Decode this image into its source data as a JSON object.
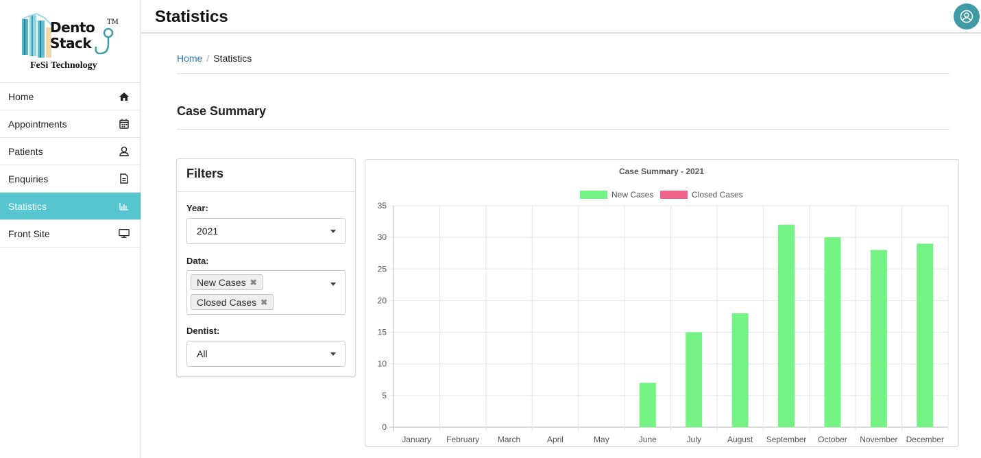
{
  "sidebar": {
    "logo": {
      "line1": "Dento",
      "line2": "Stack",
      "tm": "TM",
      "sub": "FeSi Technology"
    },
    "items": [
      {
        "label": "Home",
        "icon": "home-icon"
      },
      {
        "label": "Appointments",
        "icon": "calendar-icon"
      },
      {
        "label": "Patients",
        "icon": "user-icon"
      },
      {
        "label": "Enquiries",
        "icon": "document-icon"
      },
      {
        "label": "Statistics",
        "icon": "bar-chart-icon",
        "active": true
      },
      {
        "label": "Front Site",
        "icon": "monitor-icon"
      }
    ]
  },
  "header": {
    "title": "Statistics",
    "avatar_icon": "user-circle-icon"
  },
  "breadcrumb": {
    "home": "Home",
    "separator": "/",
    "current": "Statistics"
  },
  "section": {
    "title": "Case Summary"
  },
  "filters": {
    "title": "Filters",
    "year": {
      "label": "Year:",
      "value": "2021"
    },
    "data": {
      "label": "Data:",
      "tags": [
        "New Cases",
        "Closed Cases"
      ],
      "remove_glyph": "✖"
    },
    "dentist": {
      "label": "Dentist:",
      "value": "All"
    }
  },
  "colors": {
    "accent": "#56c5d0",
    "avatar": "#3e9aa3",
    "new_cases": "#74f284",
    "closed_cases": "#f0648a",
    "link": "#2c7bb6"
  },
  "chart_data": {
    "type": "bar",
    "title": "Case Summary - 2021",
    "categories": [
      "January",
      "February",
      "March",
      "April",
      "May",
      "June",
      "July",
      "August",
      "September",
      "October",
      "November",
      "December"
    ],
    "series": [
      {
        "name": "New Cases",
        "color": "#74f284",
        "values": [
          0,
          0,
          0,
          0,
          0,
          7,
          15,
          18,
          32,
          30,
          28,
          29
        ]
      },
      {
        "name": "Closed Cases",
        "color": "#f0648a",
        "values": [
          0,
          0,
          0,
          0,
          0,
          0,
          0,
          0,
          0,
          0,
          0,
          0
        ]
      }
    ],
    "ylim": [
      0,
      35
    ],
    "yticks": [
      0,
      5,
      10,
      15,
      20,
      25,
      30,
      35
    ],
    "grid": true,
    "legend": "top"
  }
}
